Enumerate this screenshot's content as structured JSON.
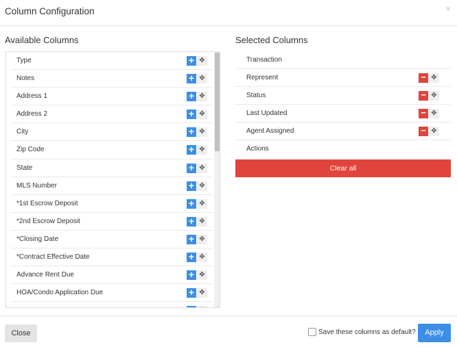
{
  "modal": {
    "title": "Column Configuration",
    "close_glyph": "×"
  },
  "available": {
    "title": "Available Columns",
    "add_glyph": "+",
    "move_glyph": "✥",
    "items": [
      {
        "label": "Type"
      },
      {
        "label": "Notes"
      },
      {
        "label": "Address 1"
      },
      {
        "label": "Address 2"
      },
      {
        "label": "City"
      },
      {
        "label": "Zip Code"
      },
      {
        "label": "State"
      },
      {
        "label": "MLS Number"
      },
      {
        "label": "*1st Escrow Deposit"
      },
      {
        "label": "*2nd Escrow Deposit"
      },
      {
        "label": "*Closing Date"
      },
      {
        "label": "*Contract Effective Date"
      },
      {
        "label": "Advance Rent Due"
      },
      {
        "label": "HOA/Condo Application Due"
      },
      {
        "label": ""
      }
    ]
  },
  "selected": {
    "title": "Selected Columns",
    "remove_glyph": "−",
    "move_glyph": "✥",
    "items": [
      {
        "label": "Transaction",
        "removable": false
      },
      {
        "label": "Represent",
        "removable": true
      },
      {
        "label": "Status",
        "removable": true
      },
      {
        "label": "Last Updated",
        "removable": true
      },
      {
        "label": "Agent Assigned",
        "removable": true
      },
      {
        "label": "Actions",
        "removable": false
      }
    ],
    "clear_label": "Clear all"
  },
  "footer": {
    "close_label": "Close",
    "default_checkbox_label": "Save these columns as default?",
    "default_checked": false,
    "apply_label": "Apply"
  },
  "colors": {
    "accent_blue": "#3d8ee6",
    "danger_red": "#e0443c"
  }
}
